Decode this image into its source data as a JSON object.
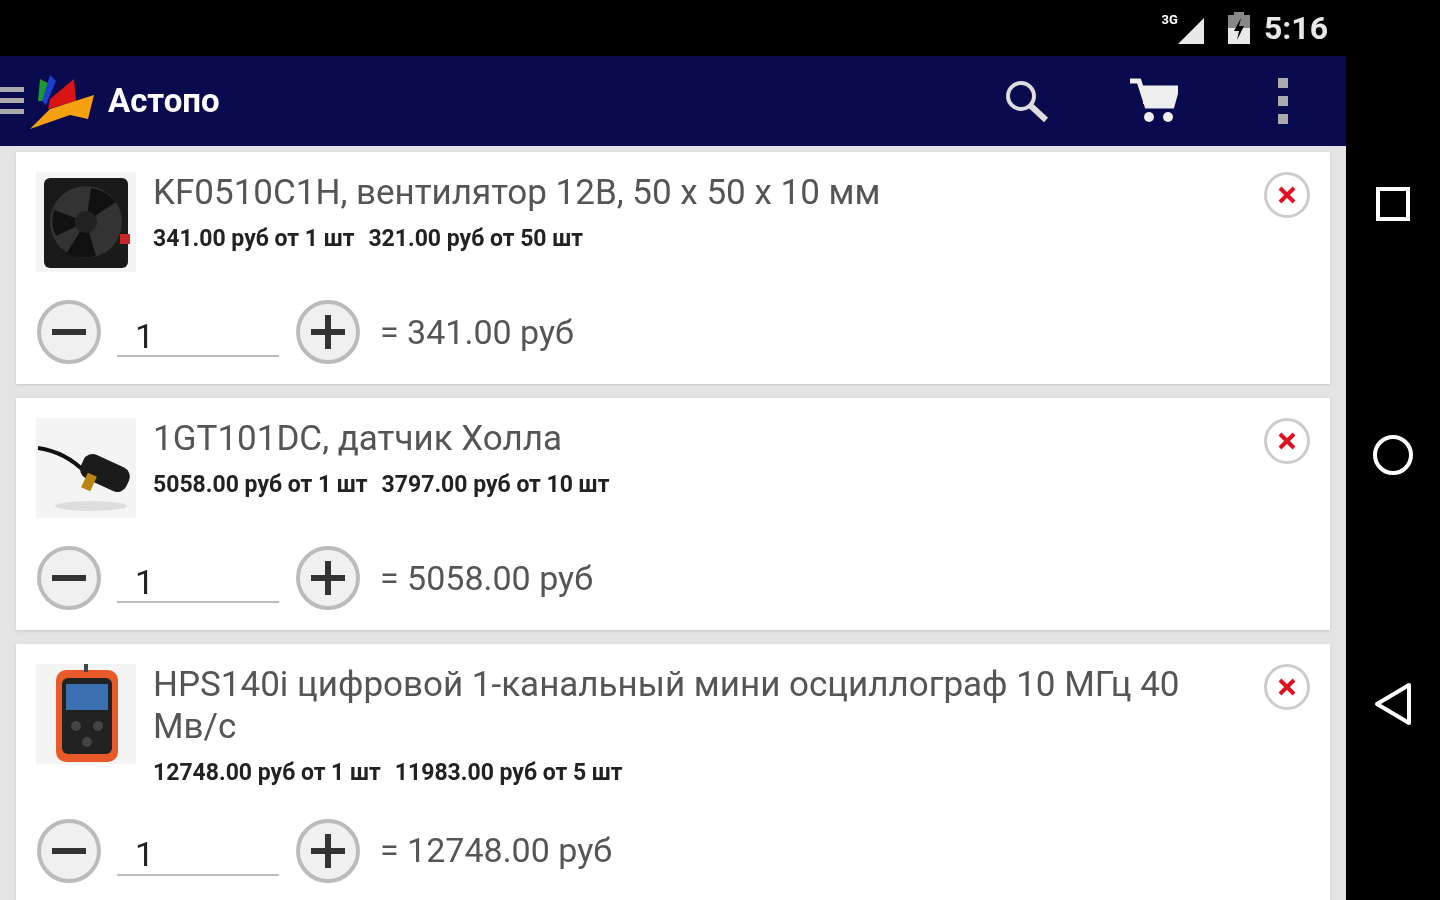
{
  "status_bar": {
    "network": "3G",
    "time": "5:16"
  },
  "app_bar": {
    "title": "Астопо"
  },
  "cart_items": [
    {
      "title": "KF0510C1H, вентилятор 12В, 50 x 50 x 10 мм",
      "prices": [
        "341.00 руб от 1 шт",
        "321.00 руб от 50 шт"
      ],
      "quantity": "1",
      "total": "= 341.00 руб",
      "image": {
        "kind": "picture"
      }
    },
    {
      "title": "1GT101DC, датчик Холла",
      "prices": [
        "5058.00 руб от 1 шт",
        "3797.00 руб от 10 шт"
      ],
      "quantity": "1",
      "total": "= 5058.00 руб",
      "image": {
        "kind": "picture"
      }
    },
    {
      "title": "HPS140i цифровой 1-канальный мини осциллограф 10 МГц 40 Мв/с",
      "prices": [
        "12748.00 руб от 1 шт",
        "11983.00 руб от 5 шт"
      ],
      "quantity": "1",
      "total": "= 12748.00 руб",
      "image": {
        "kind": "picture"
      }
    }
  ]
}
